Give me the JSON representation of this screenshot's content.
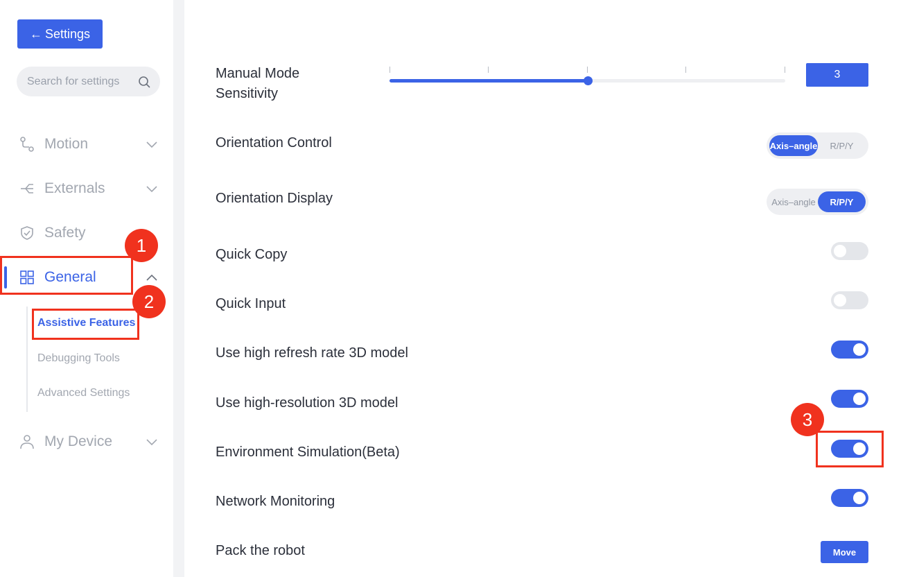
{
  "sidebar": {
    "back_label": "Settings",
    "search_placeholder": "Search for settings",
    "nav": [
      {
        "label": "Motion",
        "icon": "route-icon"
      },
      {
        "label": "Externals",
        "icon": "network-icon"
      },
      {
        "label": "Safety",
        "icon": "shield-check-icon"
      },
      {
        "label": "General",
        "icon": "grid-icon"
      },
      {
        "label": "My Device",
        "icon": "user-icon"
      }
    ],
    "general_sub": [
      {
        "label": "Assistive Features",
        "active": true
      },
      {
        "label": "Debugging Tools",
        "active": false
      },
      {
        "label": "Advanced Settings",
        "active": false
      }
    ]
  },
  "settings": {
    "sensitivity": {
      "label_line1": "Manual Mode",
      "label_line2": "Sensitivity",
      "value": "3",
      "level_fraction": 0.5
    },
    "orientation_control": {
      "label": "Orientation Control",
      "options": [
        "Axis–angle",
        "R/P/Y"
      ],
      "selected": "Axis–angle"
    },
    "orientation_display": {
      "label": "Orientation Display",
      "options": [
        "Axis–angle",
        "R/P/Y"
      ],
      "selected": "R/P/Y"
    },
    "quick_copy": {
      "label": "Quick Copy",
      "on": false
    },
    "quick_input": {
      "label": "Quick Input",
      "on": false
    },
    "high_refresh": {
      "label": "Use high refresh rate 3D model",
      "on": true
    },
    "high_res": {
      "label": "Use high-resolution 3D model",
      "on": true
    },
    "env_sim": {
      "label": "Environment Simulation(Beta)",
      "on": true
    },
    "network": {
      "label": "Network Monitoring",
      "on": true
    },
    "pack": {
      "label": "Pack the robot",
      "button": "Move"
    }
  },
  "annotations": {
    "badge1": "1",
    "badge2": "2",
    "badge3": "3"
  },
  "colors": {
    "accent": "#3b63e6",
    "annotation": "#f0321e"
  }
}
